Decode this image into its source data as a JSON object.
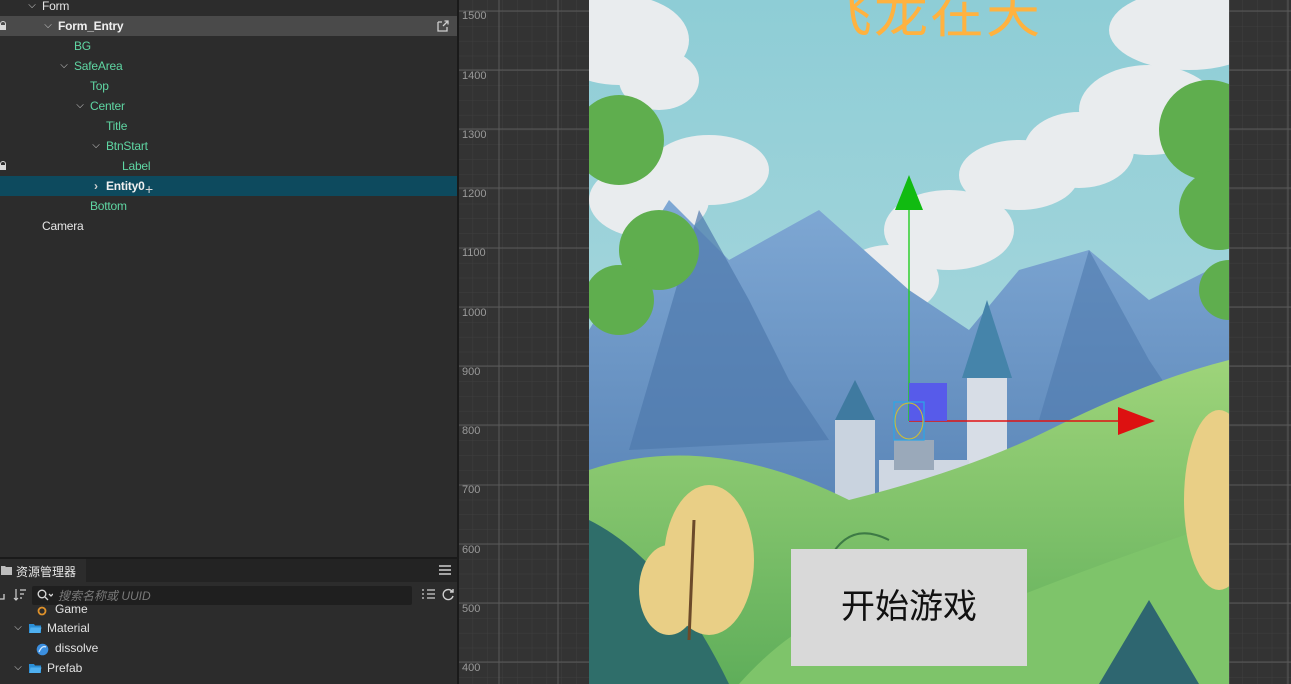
{
  "hierarchy": {
    "rows": [
      {
        "label": "Form"
      },
      {
        "label": "Form_Entry"
      },
      {
        "label": "BG"
      },
      {
        "label": "SafeArea"
      },
      {
        "label": "Top"
      },
      {
        "label": "Center"
      },
      {
        "label": "Title"
      },
      {
        "label": "BtnStart"
      },
      {
        "label": "Label"
      },
      {
        "label": "Entity0"
      },
      {
        "label": "Bottom"
      },
      {
        "label": "Camera"
      }
    ]
  },
  "assets": {
    "tab_label": "资源管理器",
    "search_placeholder": "搜索名称或 UUID",
    "items": [
      {
        "label": "Game",
        "icon": "scene-icon"
      },
      {
        "label": "Material",
        "icon": "folder-icon"
      },
      {
        "label": "dissolve",
        "icon": "material-icon"
      },
      {
        "label": "Prefab",
        "icon": "folder-icon"
      }
    ]
  },
  "scene": {
    "ruler_labels": [
      "1500",
      "1400",
      "1300",
      "1200",
      "1100",
      "1000",
      "900",
      "800",
      "700",
      "600",
      "500",
      "400"
    ],
    "game_title": "飞龙在天",
    "start_button_label": "开始游戏",
    "colors": {
      "title": "#ffb23f",
      "gizmo_x": "#e01010",
      "gizmo_y": "#10c010",
      "gizmo_xy": "#5050ee",
      "selection": "#0d4a5e"
    }
  }
}
